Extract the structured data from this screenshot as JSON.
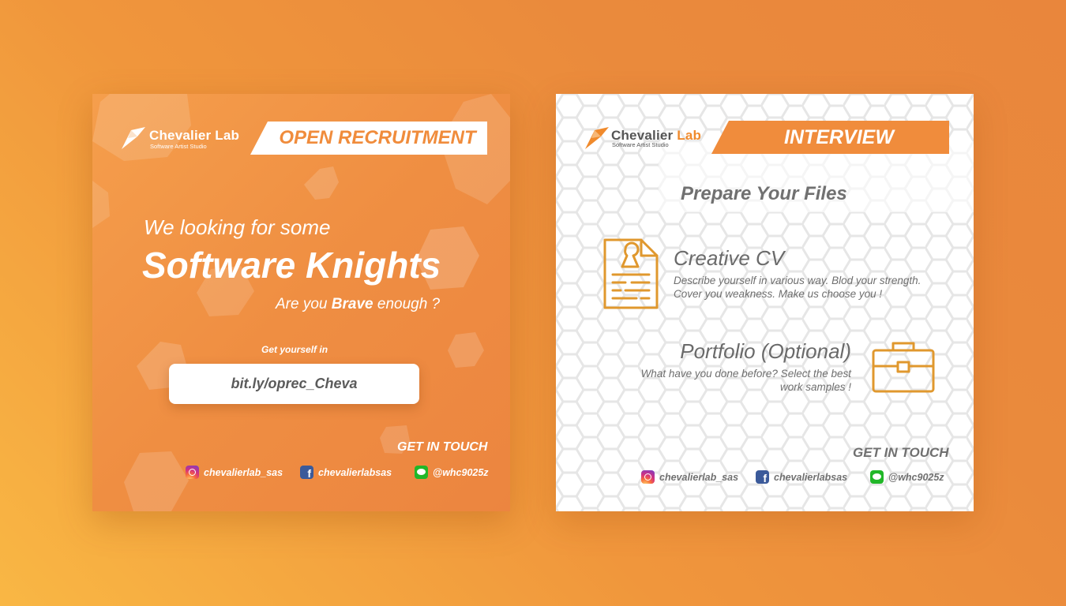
{
  "brand": {
    "name_part1": "Chevalier",
    "name_part2": "Lab",
    "subtitle": "Software Artist Studio"
  },
  "left_card": {
    "banner": "OPEN RECRUITMENT",
    "line1": "We looking for some",
    "headline": "Software Knights",
    "question_pre": "Are you",
    "question_bold": "Brave",
    "question_post": "enough ?",
    "link_label": "Get yourself in",
    "link": "bit.ly/oprec_Cheva",
    "contact_heading": "GET IN TOUCH"
  },
  "right_card": {
    "banner": "INTERVIEW",
    "section_title": "Prepare Your Files",
    "items": [
      {
        "title": "Creative CV",
        "desc_line1": "Describe yourself in various way. Blod your strength.",
        "desc_line2": "Cover you weakness. Make us choose you !",
        "icon": "cv-document-icon"
      },
      {
        "title": "Portfolio (Optional)",
        "desc_line1": "What have you done before? Select the best",
        "desc_line2": "work samples !",
        "icon": "briefcase-icon"
      }
    ],
    "contact_heading": "GET IN TOUCH"
  },
  "socials": [
    {
      "network": "instagram",
      "icon": "instagram-icon",
      "handle": "chevalierlab_sas"
    },
    {
      "network": "facebook",
      "icon": "facebook-icon",
      "handle": "chevalierlabsas"
    },
    {
      "network": "line",
      "icon": "line-icon",
      "handle": "@whc9025z"
    }
  ],
  "colors": {
    "accent_orange": "#f08c3c",
    "logo_orange": "#f08a2c",
    "outline_orange": "#e0982e",
    "text_gray": "#707070",
    "white": "#ffffff"
  }
}
